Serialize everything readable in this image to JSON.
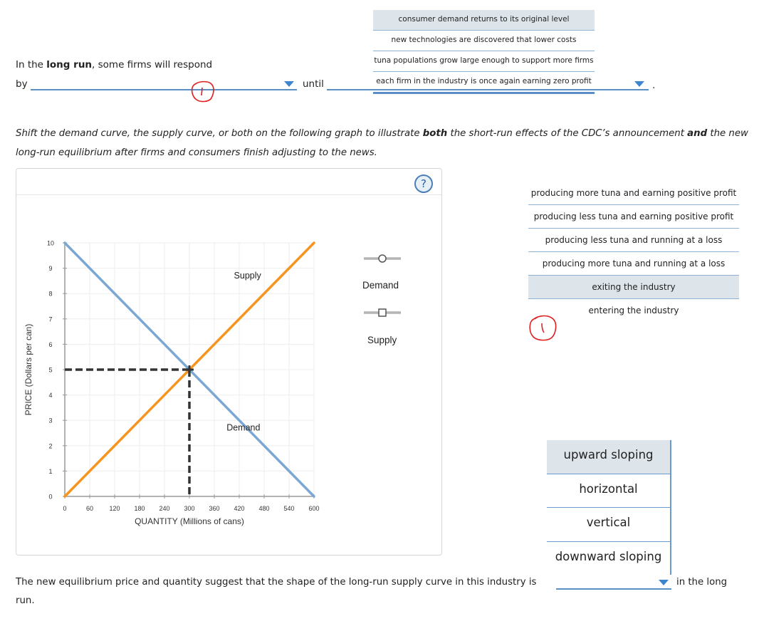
{
  "question1": {
    "intro_prefix": "In the ",
    "intro_bold": "long run",
    "intro_suffix": ", some firms will respond",
    "by_label": "by",
    "until_label": "until",
    "period": ".",
    "dropdown_by": {
      "selected": "",
      "options": [
        "producing more tuna and earning positive profit",
        "producing less tuna and earning positive profit",
        "producing less tuna and running at a loss",
        "producing more tuna and running at a loss",
        "exiting the industry",
        "entering the industry"
      ],
      "highlighted": "exiting the industry"
    },
    "dropdown_until": {
      "selected": "",
      "options": [
        "consumer demand returns to its original level",
        "new technologies are discovered that lower costs",
        "tuna populations grow large enough to support more firms",
        "each firm in the industry is once again earning zero profit"
      ],
      "highlighted": "consumer demand returns to its original level"
    },
    "annotation_mark": "1"
  },
  "instructions": {
    "p1": "Shift the demand curve, the supply curve, or both on the following graph to illustrate ",
    "b1": "both",
    "p2": " the short-run effects of the CDC’s announcement ",
    "b2": "and",
    "p3": " the new long-run equilibrium after firms and consumers finish adjusting to the news."
  },
  "graph": {
    "help_glyph": "?",
    "legend": [
      {
        "label": "Demand",
        "marker": "circle"
      },
      {
        "label": "Supply",
        "marker": "square"
      }
    ],
    "colors": {
      "demand": "#7ba7d4",
      "supply": "#f7941d",
      "equilibrium": "#333333",
      "grid": "#eeeeee",
      "axis": "#999999"
    }
  },
  "chart_data": {
    "type": "line",
    "title": "",
    "xlabel": "QUANTITY (Millions of cans)",
    "ylabel": "PRICE (Dollars per can)",
    "xlim": [
      0,
      600
    ],
    "ylim": [
      0,
      10
    ],
    "x_ticks": [
      0,
      60,
      120,
      180,
      240,
      300,
      360,
      420,
      480,
      540,
      600
    ],
    "y_ticks": [
      0,
      1,
      2,
      3,
      4,
      5,
      6,
      7,
      8,
      9,
      10
    ],
    "grid": true,
    "series": [
      {
        "name": "Demand",
        "label": "Demand",
        "points": [
          [
            0,
            10
          ],
          [
            600,
            0
          ]
        ],
        "label_at": [
          430,
          2.6
        ]
      },
      {
        "name": "Supply",
        "label": "Supply",
        "points": [
          [
            0,
            0
          ],
          [
            600,
            10
          ]
        ],
        "label_at": [
          440,
          8.6
        ]
      }
    ],
    "equilibrium": {
      "quantity": 300,
      "price": 5,
      "dashed_guides": true
    }
  },
  "question2": {
    "text": "The new equilibrium price and quantity suggest that the shape of the long-run supply curve in this industry is",
    "after": "in the long",
    "wrap": "run.",
    "dropdown_shape": {
      "selected": "",
      "options": [
        "upward sloping",
        "horizontal",
        "vertical",
        "downward sloping"
      ],
      "highlighted": "upward sloping"
    }
  }
}
